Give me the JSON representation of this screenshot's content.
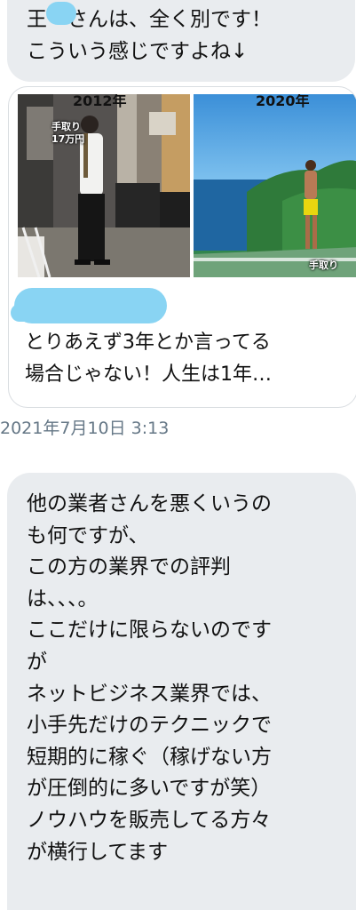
{
  "top_message": {
    "lines": [
      "王　さんは、全く別です！",
      "こういう感じですよね↓"
    ]
  },
  "link_card": {
    "image": {
      "left_year": "2012年",
      "right_year": "2020年",
      "left_overlay": [
        "手取り",
        "17万円"
      ],
      "right_overlay": "手取り"
    },
    "title_lines": [
      "とりあえず3年とか言ってる",
      "場合じゃない！人生は1年…"
    ]
  },
  "timestamp": "2021年7月10日 3:13",
  "bottom_message": {
    "lines": [
      "他の業者さんを悪くいうの",
      "も何ですが、",
      "この方の業界での評判",
      "は、、、。",
      "ここだけに限らないのです",
      "が",
      "ネットビジネス業界では、",
      "小手先だけのテクニックで",
      "短期的に稼ぐ（稼げない方",
      "が圧倒的に多いですが笑）",
      "ノウハウを販売してる方々",
      "が横行してます"
    ]
  },
  "colors": {
    "bubble_bg": "#e9ecef",
    "timestamp": "#657786",
    "redaction": "#89d4f3"
  }
}
